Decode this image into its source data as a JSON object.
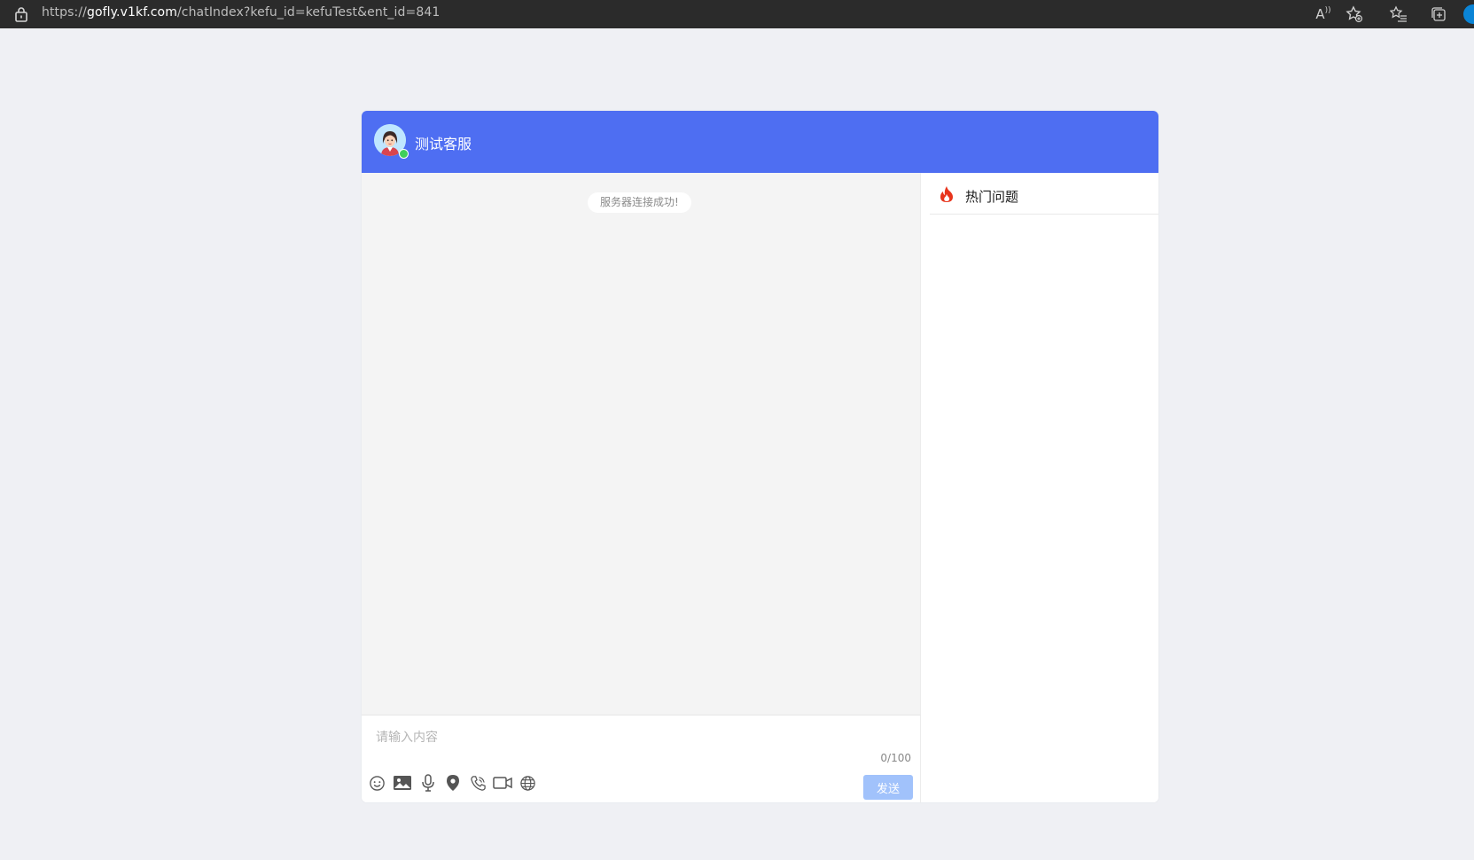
{
  "browser": {
    "url_protocol": "https://",
    "url_host": "gofly.v1kf.com",
    "url_path": "/chatIndex?kefu_id=kefuTest&ent_id=841",
    "read_aloud_label": "A"
  },
  "header": {
    "agent_name": "测试客服",
    "status": "online"
  },
  "chat": {
    "system_message": "服务器连接成功!"
  },
  "input": {
    "placeholder": "请输入内容",
    "value": "",
    "char_count": "0/100",
    "send_label": "发送",
    "tools": [
      "emoji-icon",
      "image-icon",
      "microphone-icon",
      "location-icon",
      "phone-icon",
      "video-icon",
      "globe-icon"
    ]
  },
  "sidebar": {
    "title": "热门问题"
  },
  "colors": {
    "header_blue": "#4e6ef2",
    "send_button": "#a1c2fb",
    "online": "#3fce5b",
    "fire": "#e8341c"
  }
}
